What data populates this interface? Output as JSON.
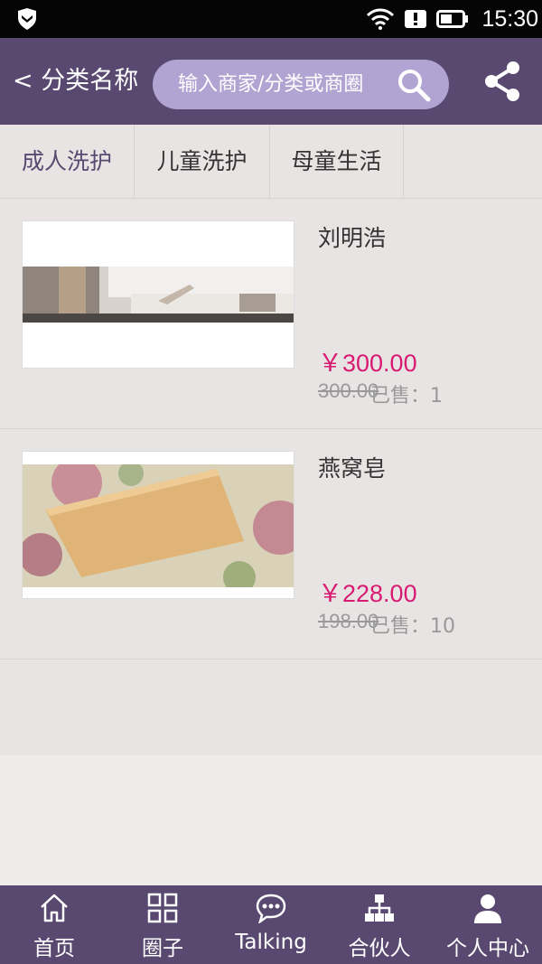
{
  "status_bar": {
    "time": "15:30"
  },
  "header": {
    "back_label": "< 分类名称",
    "search_placeholder": "输入商家/分类或商圈"
  },
  "tabs": [
    {
      "label": "成人洗护",
      "active": true
    },
    {
      "label": "儿童洗护",
      "active": false
    },
    {
      "label": "母童生活",
      "active": false
    }
  ],
  "products": [
    {
      "name": "刘明浩",
      "price": "￥300.00",
      "old_price": "300.00",
      "sold": "已售：1",
      "image": "bedroom-photo"
    },
    {
      "name": "燕窝皂",
      "price": "￥228.00",
      "old_price": "198.00",
      "sold": "已售：10",
      "image": "soap-photo"
    }
  ],
  "bottom_nav": [
    {
      "label": "首页",
      "icon": "home-icon"
    },
    {
      "label": "圈子",
      "icon": "grid-icon"
    },
    {
      "label": "Talking",
      "icon": "chat-icon"
    },
    {
      "label": "合伙人",
      "icon": "org-chart-icon"
    },
    {
      "label": "个人中心",
      "icon": "user-icon"
    }
  ],
  "colors": {
    "primary": "#594970",
    "search_bg": "#b1a4d2",
    "price": "#d81b72"
  }
}
